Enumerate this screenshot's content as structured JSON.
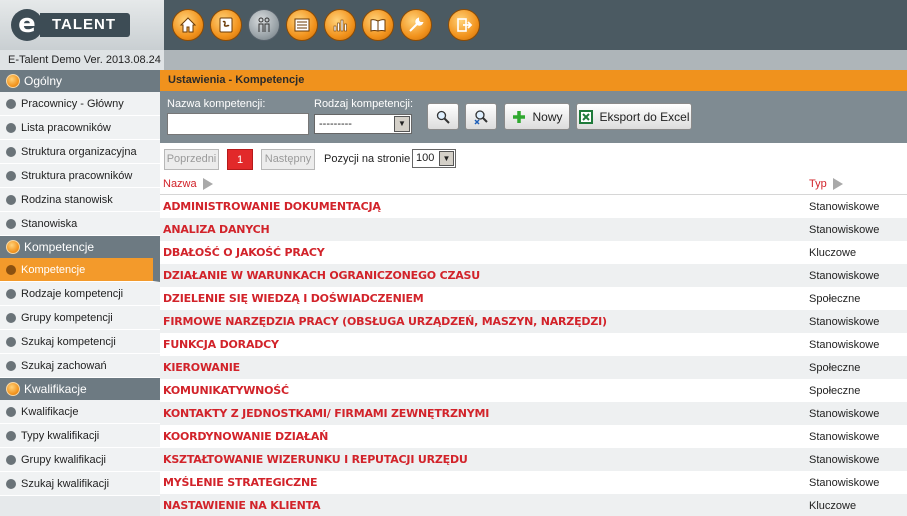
{
  "app": {
    "logo_letter": "e",
    "logo_text": "TALENT",
    "version": "E-Talent Demo Ver. 2013.08.24"
  },
  "toolbar_icons": [
    "home-icon",
    "phonebook-icon",
    "people-icon",
    "list-icon",
    "chart-icon",
    "book-icon",
    "tools-icon",
    "exit-icon"
  ],
  "sidebar": {
    "sections": [
      {
        "title": "Ogólny",
        "items": [
          "Pracownicy - Główny",
          "Lista pracowników",
          "Struktura organizacyjna",
          "Struktura pracowników",
          "Rodzina stanowisk",
          "Stanowiska"
        ]
      },
      {
        "title": "Kompetencje",
        "items": [
          "Kompetencje",
          "Rodzaje kompetencji",
          "Grupy kompetencji",
          "Szukaj kompetencji",
          "Szukaj zachowań"
        ]
      },
      {
        "title": "Kwalifikacje",
        "items": [
          "Kwalifikacje",
          "Typy kwalifikacji",
          "Grupy kwalifikacji",
          "Szukaj kwalifikacji"
        ]
      }
    ],
    "active_item": "Kompetencje"
  },
  "main": {
    "title": "Ustawienia - Kompetencje",
    "filters": {
      "name_label": "Nazwa kompetencji:",
      "name_value": "",
      "type_label": "Rodzaj kompetencji:",
      "type_value": "---------"
    },
    "buttons": {
      "new": "Nowy",
      "export": "Eksport do Excel"
    },
    "pager": {
      "prev": "Poprzedni",
      "current": "1",
      "next": "Następny",
      "per_page_label": "Pozycji na stronie",
      "per_page_value": "100"
    },
    "table": {
      "col_name": "Nazwa",
      "col_type": "Typ",
      "rows": [
        {
          "name": "ADMINISTROWANIE DOKUMENTACJĄ",
          "type": "Stanowiskowe"
        },
        {
          "name": "ANALIZA DANYCH",
          "type": "Stanowiskowe"
        },
        {
          "name": "DBAŁOŚĆ O JAKOŚĆ PRACY",
          "type": "Kluczowe"
        },
        {
          "name": "DZIAŁANIE W WARUNKACH OGRANICZONEGO CZASU",
          "type": "Stanowiskowe"
        },
        {
          "name": "DZIELENIE SIĘ WIEDZĄ I DOŚWIADCZENIEM",
          "type": "Społeczne"
        },
        {
          "name": "FIRMOWE NARZĘDZIA PRACY (OBSŁUGA URZĄDZEŃ, MASZYN, NARZĘDZI)",
          "type": "Stanowiskowe"
        },
        {
          "name": "FUNKCJA DORADCY",
          "type": "Stanowiskowe"
        },
        {
          "name": "KIEROWANIE",
          "type": "Społeczne"
        },
        {
          "name": "KOMUNIKATYWNOŚĆ",
          "type": "Społeczne"
        },
        {
          "name": "KONTAKTY Z JEDNOSTKAMI/ FIRMAMI ZEWNĘTRZNYMI",
          "type": "Stanowiskowe"
        },
        {
          "name": "KOORDYNOWANIE DZIAŁAŃ",
          "type": "Stanowiskowe"
        },
        {
          "name": "KSZTAŁTOWANIE WIZERUNKU I REPUTACJI URZĘDU",
          "type": "Stanowiskowe"
        },
        {
          "name": "MYŚLENIE STRATEGICZNE",
          "type": "Stanowiskowe"
        },
        {
          "name": "NASTAWIENIE NA KLIENTA",
          "type": "Kluczowe"
        }
      ]
    }
  }
}
